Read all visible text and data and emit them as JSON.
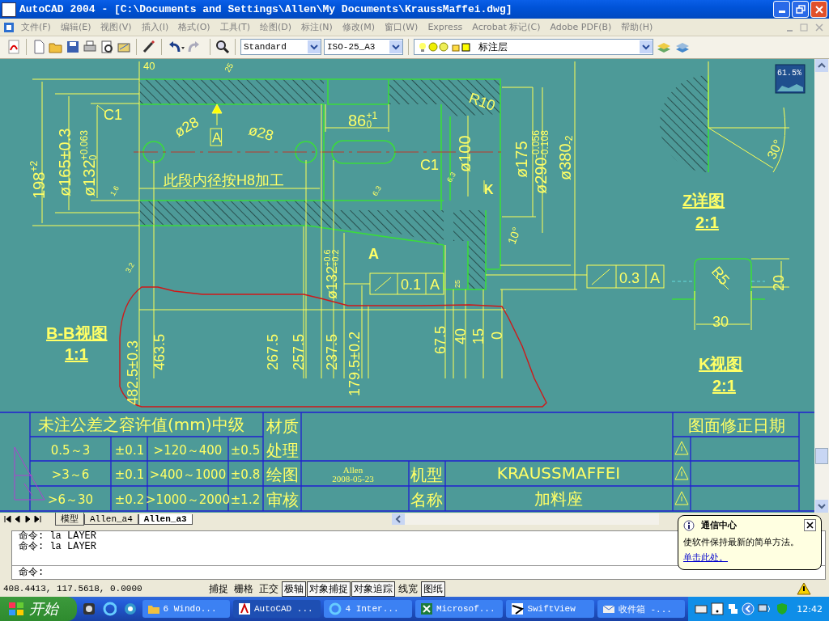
{
  "window": {
    "title": "AutoCAD 2004 - [C:\\Documents and Settings\\Allen\\My Documents\\KraussMaffei.dwg]"
  },
  "menu": [
    "文件(F)",
    "编辑(E)",
    "视图(V)",
    "插入(I)",
    "格式(O)",
    "工具(T)",
    "绘图(D)",
    "标注(N)",
    "修改(M)",
    "窗口(W)",
    "Express",
    "Acrobat 标记(C)",
    "Adobe PDF(B)",
    "帮助(H)"
  ],
  "toolbar": {
    "text_style": "Standard",
    "dim_style": "ISO-25_A3",
    "layer": "标注层"
  },
  "drawing": {
    "zoom_badge": "61.5%",
    "labels": [
      {
        "text": "40"
      },
      {
        "text": "25"
      },
      {
        "text": "198",
        "upper": "+2"
      },
      {
        "text": "ø165±0.3"
      },
      {
        "text": "ø132",
        "upper": "+0.063",
        "lower": "0"
      },
      {
        "text": "C1"
      },
      {
        "text": "ø28"
      },
      {
        "text": "A",
        "kind": "datum"
      },
      {
        "text": "ø28"
      },
      {
        "text": "86",
        "upper": "+1",
        "lower": "0"
      },
      {
        "text": "R10"
      },
      {
        "text": "此段内径按H8加工"
      },
      {
        "text": "C1"
      },
      {
        "text": "ø100"
      },
      {
        "text": "K",
        "kind": "bold"
      },
      {
        "text": "ø175"
      },
      {
        "text": "ø290",
        "upper": "-0.056",
        "lower": "-0.108"
      },
      {
        "text": "ø380",
        "lower": "-2"
      },
      {
        "text": "10°"
      },
      {
        "text": "A",
        "kind": "bold"
      },
      {
        "text": "ø132",
        "upper": "+0.6",
        "lower": "+0.2"
      },
      {
        "text": "B-B视图",
        "kind": "title"
      },
      {
        "text": "1:1",
        "kind": "title"
      },
      {
        "text": "482.5±0.3"
      },
      {
        "text": "463.5"
      },
      {
        "text": "267.5"
      },
      {
        "text": "257.5"
      },
      {
        "text": "237.5"
      },
      {
        "text": "179.5±0.2"
      },
      {
        "text": "67.5"
      },
      {
        "text": "40"
      },
      {
        "text": "15"
      },
      {
        "text": "0"
      },
      {
        "text": "Z详图",
        "kind": "title"
      },
      {
        "text": "2:1",
        "kind": "title"
      },
      {
        "text": "30°"
      },
      {
        "text": "R5"
      },
      {
        "text": "20"
      },
      {
        "text": "30"
      },
      {
        "text": "K视图",
        "kind": "title"
      },
      {
        "text": "2:1",
        "kind": "title"
      },
      {
        "text": "1.6"
      },
      {
        "text": "6.3"
      },
      {
        "text": "6.3"
      },
      {
        "text": "3.2"
      },
      {
        "text": "25"
      }
    ],
    "tolerance_frames": [
      {
        "value": "0.1",
        "datum": "A"
      },
      {
        "value": "0.3",
        "datum": "A"
      }
    ],
    "title_block": {
      "tolerance_heading": "未注公差之容许值(mm)中级",
      "tolerance_rows": [
        {
          "range": "0.5～3",
          "tol": "±0.1",
          "range_2": ">120～400",
          "tol_2": "±0.5"
        },
        {
          "range": ">3～6",
          "tol": "±0.1",
          "range_2": ">400～1000",
          "tol_2": "±0.8"
        },
        {
          "range": ">6～30",
          "tol": "±0.2",
          "range_2": ">1000～2000",
          "tol_2": "±1.2"
        }
      ],
      "labels": [
        "材质",
        "处理",
        "绘图",
        "审核"
      ],
      "drawn_by": "Allen",
      "date": "2008-05-23",
      "model_label": "机型",
      "model": "KRAUSSMAFFEI",
      "name_label": "名称",
      "part_name": "加料座",
      "revision_heading": "图面修正日期"
    }
  },
  "layout_tabs": [
    {
      "label": "模型",
      "selected": false
    },
    {
      "label": "Allen_a4",
      "selected": false
    },
    {
      "label": "Allen_a3",
      "selected": true
    }
  ],
  "command_lines": [
    "命令: la LAYER",
    "命令: la LAYER"
  ],
  "command_prompt": "命令:",
  "status_bar": {
    "coordinates": "408.4413, 117.5618, 0.0000",
    "toggles": [
      {
        "label": "捕捉",
        "on": false
      },
      {
        "label": "栅格",
        "on": false
      },
      {
        "label": "正交",
        "on": false
      },
      {
        "label": "极轴",
        "on": true
      },
      {
        "label": "对象捕捉",
        "on": true
      },
      {
        "label": "对象追踪",
        "on": true
      },
      {
        "label": "线宽",
        "on": false
      },
      {
        "label": "图纸",
        "on": true
      }
    ]
  },
  "balloon": {
    "title": "通信中心",
    "message": "使软件保持最新的简单方法。",
    "link": "单击此处。"
  },
  "taskbar": {
    "start": "开始",
    "tasks": [
      {
        "label": "6 Windo...",
        "selected": false
      },
      {
        "label": "AutoCAD ...",
        "selected": true
      },
      {
        "label": "4 Inter...",
        "selected": false
      },
      {
        "label": "Microsof...",
        "selected": false
      },
      {
        "label": "SwiftView",
        "selected": false
      },
      {
        "label": "收件箱 -...",
        "selected": false
      }
    ],
    "clock": "12:42"
  }
}
